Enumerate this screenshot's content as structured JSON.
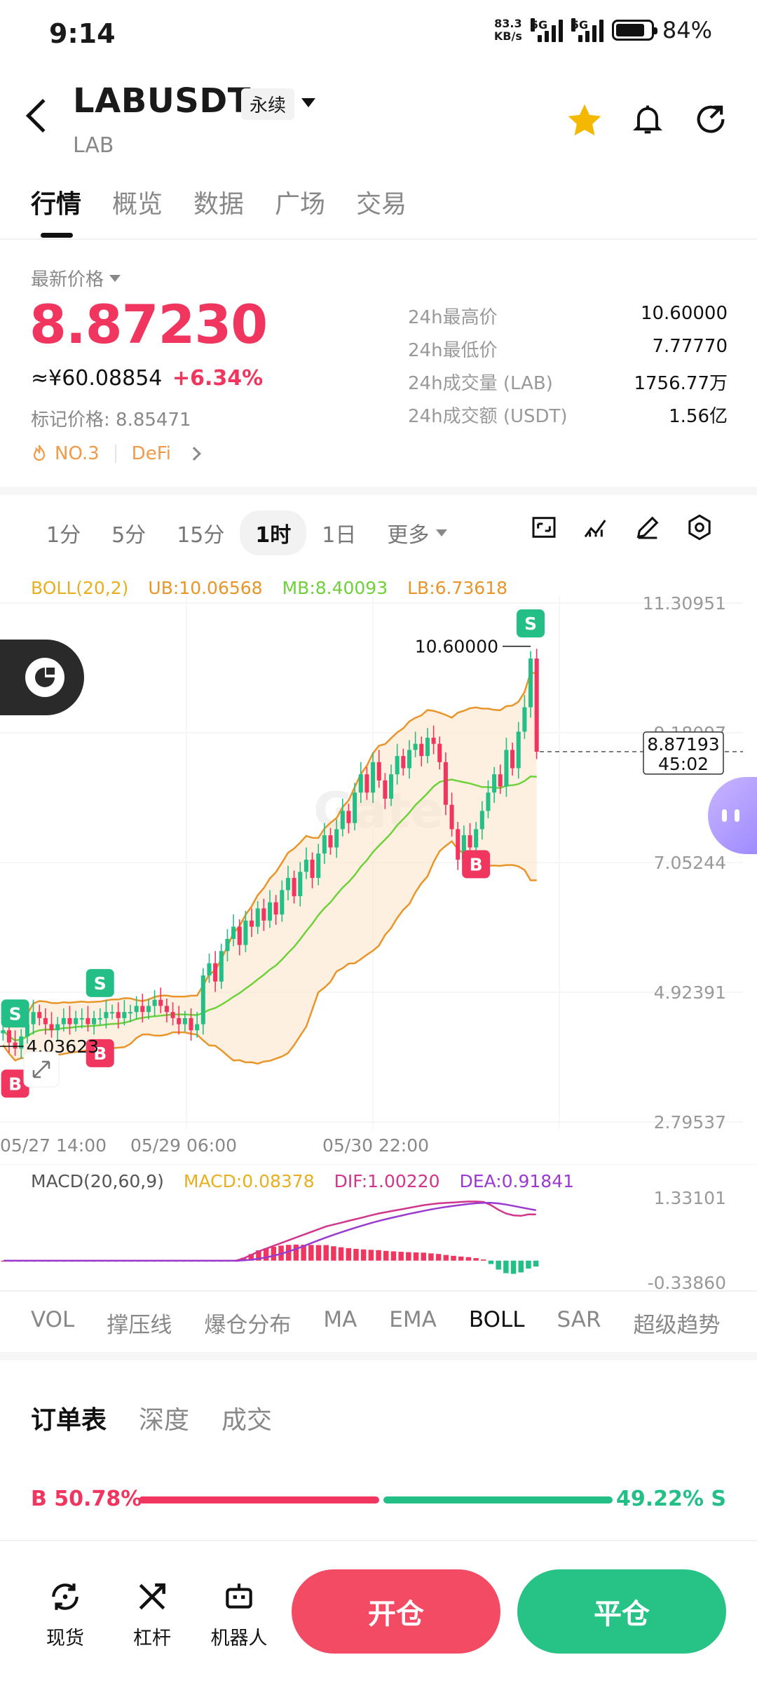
{
  "status": {
    "time": "9:14",
    "net_speed_value": "83.3",
    "net_speed_unit": "KB/s",
    "sig1": "5G",
    "sig2": "5G",
    "battery": "84%",
    "battery_level": 0.84
  },
  "header": {
    "symbol": "LABUSDT",
    "contract_type": "永续",
    "base": "LAB"
  },
  "tabs": [
    "行情",
    "概览",
    "数据",
    "广场",
    "交易"
  ],
  "price": {
    "label": "最新价格",
    "last": "8.87230",
    "cny": "≈¥60.08854",
    "change": "+6.34%",
    "mark": "标记价格: 8.85471",
    "rank": "NO.3",
    "sector": "DeFi"
  },
  "stats": [
    {
      "label": "24h最高价",
      "value": "10.60000"
    },
    {
      "label": "24h最低价",
      "value": "7.77770"
    },
    {
      "label": "24h成交量 (LAB)",
      "value": "1756.77万"
    },
    {
      "label": "24h成交额 (USDT)",
      "value": "1.56亿"
    }
  ],
  "timeframes": [
    "1分",
    "5分",
    "15分",
    "1时",
    "1日"
  ],
  "timeframe_selected": "1时",
  "timeframe_more": "更多",
  "boll": {
    "name": "BOLL(20,2)",
    "ub": "UB:10.06568",
    "mb": "MB:8.40093",
    "lb": "LB:6.73618"
  },
  "macd": {
    "name": "MACD(20,60,9)",
    "macd": "MACD:0.08378",
    "dif": "DIF:1.00220",
    "dea": "DEA:0.91841",
    "axis_top": "1.33101",
    "axis_bottom": "-0.33860"
  },
  "chart_data": {
    "type": "candlestick",
    "y_ticks": [
      "11.30951",
      "9.18097",
      "7.05244",
      "4.92391",
      "2.79537"
    ],
    "ylim": [
      2.79537,
      11.30951
    ],
    "x_ticks": [
      "05/27 14:00",
      "05/29 06:00",
      "05/30 22:00"
    ],
    "high_label": "10.60000",
    "low_label": "4.03623",
    "current_price": "8.87193",
    "countdown": "45:02",
    "closes": [
      4.3,
      4.1,
      4.0,
      4.2,
      4.4,
      4.6,
      4.5,
      4.4,
      4.3,
      4.4,
      4.5,
      4.4,
      4.5,
      4.5,
      4.4,
      4.5,
      4.5,
      4.6,
      4.6,
      4.5,
      4.6,
      4.6,
      4.7,
      4.6,
      4.7,
      4.8,
      4.7,
      4.6,
      4.5,
      4.4,
      4.5,
      4.3,
      4.4,
      5.2,
      5.4,
      5.1,
      5.6,
      5.8,
      6.0,
      5.7,
      6.1,
      6.0,
      6.3,
      6.1,
      6.4,
      6.2,
      6.6,
      6.8,
      6.5,
      6.9,
      7.1,
      6.8,
      7.2,
      7.5,
      7.3,
      7.6,
      7.9,
      7.7,
      8.2,
      8.5,
      8.2,
      8.7,
      8.4,
      8.1,
      8.5,
      8.8,
      8.6,
      8.9,
      9.0,
      8.8,
      9.1,
      9.0,
      8.7,
      8.0,
      7.6,
      7.1,
      7.5,
      7.3,
      7.6,
      7.9,
      8.2,
      8.5,
      8.3,
      8.9,
      8.6,
      9.2,
      9.6,
      10.4,
      8.87
    ],
    "signals": [
      {
        "label": "S",
        "index": 2
      },
      {
        "label": "B",
        "index": 2
      },
      {
        "label": "S",
        "index": 16
      },
      {
        "label": "B",
        "index": 16
      },
      {
        "label": "B",
        "index": 78
      },
      {
        "label": "S",
        "index": 87
      }
    ],
    "macd_dif": [
      0,
      0,
      0,
      0,
      0,
      0,
      0,
      0,
      0,
      0,
      0,
      0,
      0,
      0,
      0,
      0,
      0,
      0,
      0,
      0,
      0,
      0,
      0,
      0,
      0,
      0,
      0,
      0,
      0,
      0,
      0,
      0,
      0.05,
      0.12,
      0.2,
      0.26,
      0.32,
      0.38,
      0.44,
      0.5,
      0.56,
      0.62,
      0.68,
      0.74,
      0.78,
      0.82,
      0.86,
      0.9,
      0.94,
      0.98,
      1.02,
      1.05,
      1.08,
      1.11,
      1.14,
      1.17,
      1.2,
      1.22,
      1.24,
      1.25,
      1.26,
      1.27,
      1.28,
      1.28,
      1.27,
      1.2,
      1.1,
      1.02,
      0.98,
      0.97,
      1.0,
      1.0
    ]
  },
  "indicators": [
    "VOL",
    "撑压线",
    "爆仓分布",
    "MA",
    "EMA",
    "BOLL",
    "SAR",
    "超级趋势"
  ],
  "indicator_selected": "BOLL",
  "orderbook_tabs": [
    "订单表",
    "深度",
    "成交"
  ],
  "ratio": {
    "buy": "B 50.78%",
    "sell": "49.22% S",
    "buy_fraction": 0.5078
  },
  "bottom_nav": {
    "spot": "现货",
    "leverage": "杠杆",
    "bot": "机器人",
    "open": "开仓",
    "close": "平仓"
  },
  "colors": {
    "up": "#23bf86",
    "down": "#f0365e",
    "boll_ub": "#e8952a",
    "boll_mb": "#6fd13a"
  }
}
